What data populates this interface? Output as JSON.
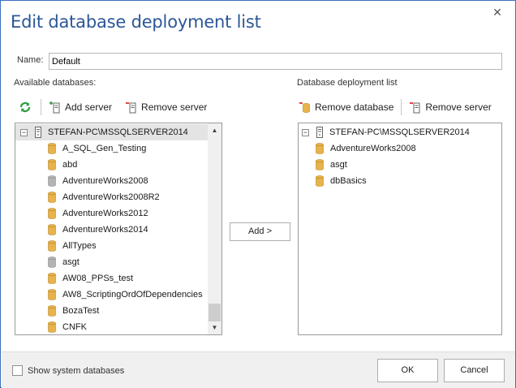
{
  "dialog": {
    "title": "Edit database deployment list",
    "close_glyph": "✕"
  },
  "name": {
    "label": "Name:",
    "value": "Default"
  },
  "available": {
    "label": "Available databases:",
    "toolbar": {
      "refresh_icon": "refresh-icon",
      "add_server": "Add server",
      "remove_server": "Remove server"
    },
    "server": "STEFAN-PC\\MSSQLSERVER2014",
    "databases": [
      {
        "name": "A_SQL_Gen_Testing",
        "status": "online"
      },
      {
        "name": "abd",
        "status": "online"
      },
      {
        "name": "AdventureWorks2008",
        "status": "offline"
      },
      {
        "name": "AdventureWorks2008R2",
        "status": "online"
      },
      {
        "name": "AdventureWorks2012",
        "status": "online"
      },
      {
        "name": "AdventureWorks2014",
        "status": "online"
      },
      {
        "name": "AllTypes",
        "status": "online"
      },
      {
        "name": "asgt",
        "status": "offline"
      },
      {
        "name": "AW08_PPSs_test",
        "status": "online"
      },
      {
        "name": "AW8_ScriptingOrdOfDependencies",
        "status": "online"
      },
      {
        "name": "BozaTest",
        "status": "online"
      },
      {
        "name": "CNFK",
        "status": "online"
      }
    ]
  },
  "deployment": {
    "label": "Database deployment list",
    "toolbar": {
      "remove_database": "Remove database",
      "remove_server": "Remove server"
    },
    "server": "STEFAN-PC\\MSSQLSERVER2014",
    "databases": [
      {
        "name": "AdventureWorks2008",
        "status": "online"
      },
      {
        "name": "asgt",
        "status": "online"
      },
      {
        "name": "dbBasics",
        "status": "online"
      }
    ]
  },
  "add_button": "Add >",
  "footer": {
    "show_system": "Show system databases",
    "ok": "OK",
    "cancel": "Cancel"
  },
  "colors": {
    "title": "#2b5797",
    "db_online": "#e8b34a",
    "db_offline": "#b4b4b4",
    "remove_red": "#d9332b",
    "refresh_green": "#2e9e3e"
  }
}
